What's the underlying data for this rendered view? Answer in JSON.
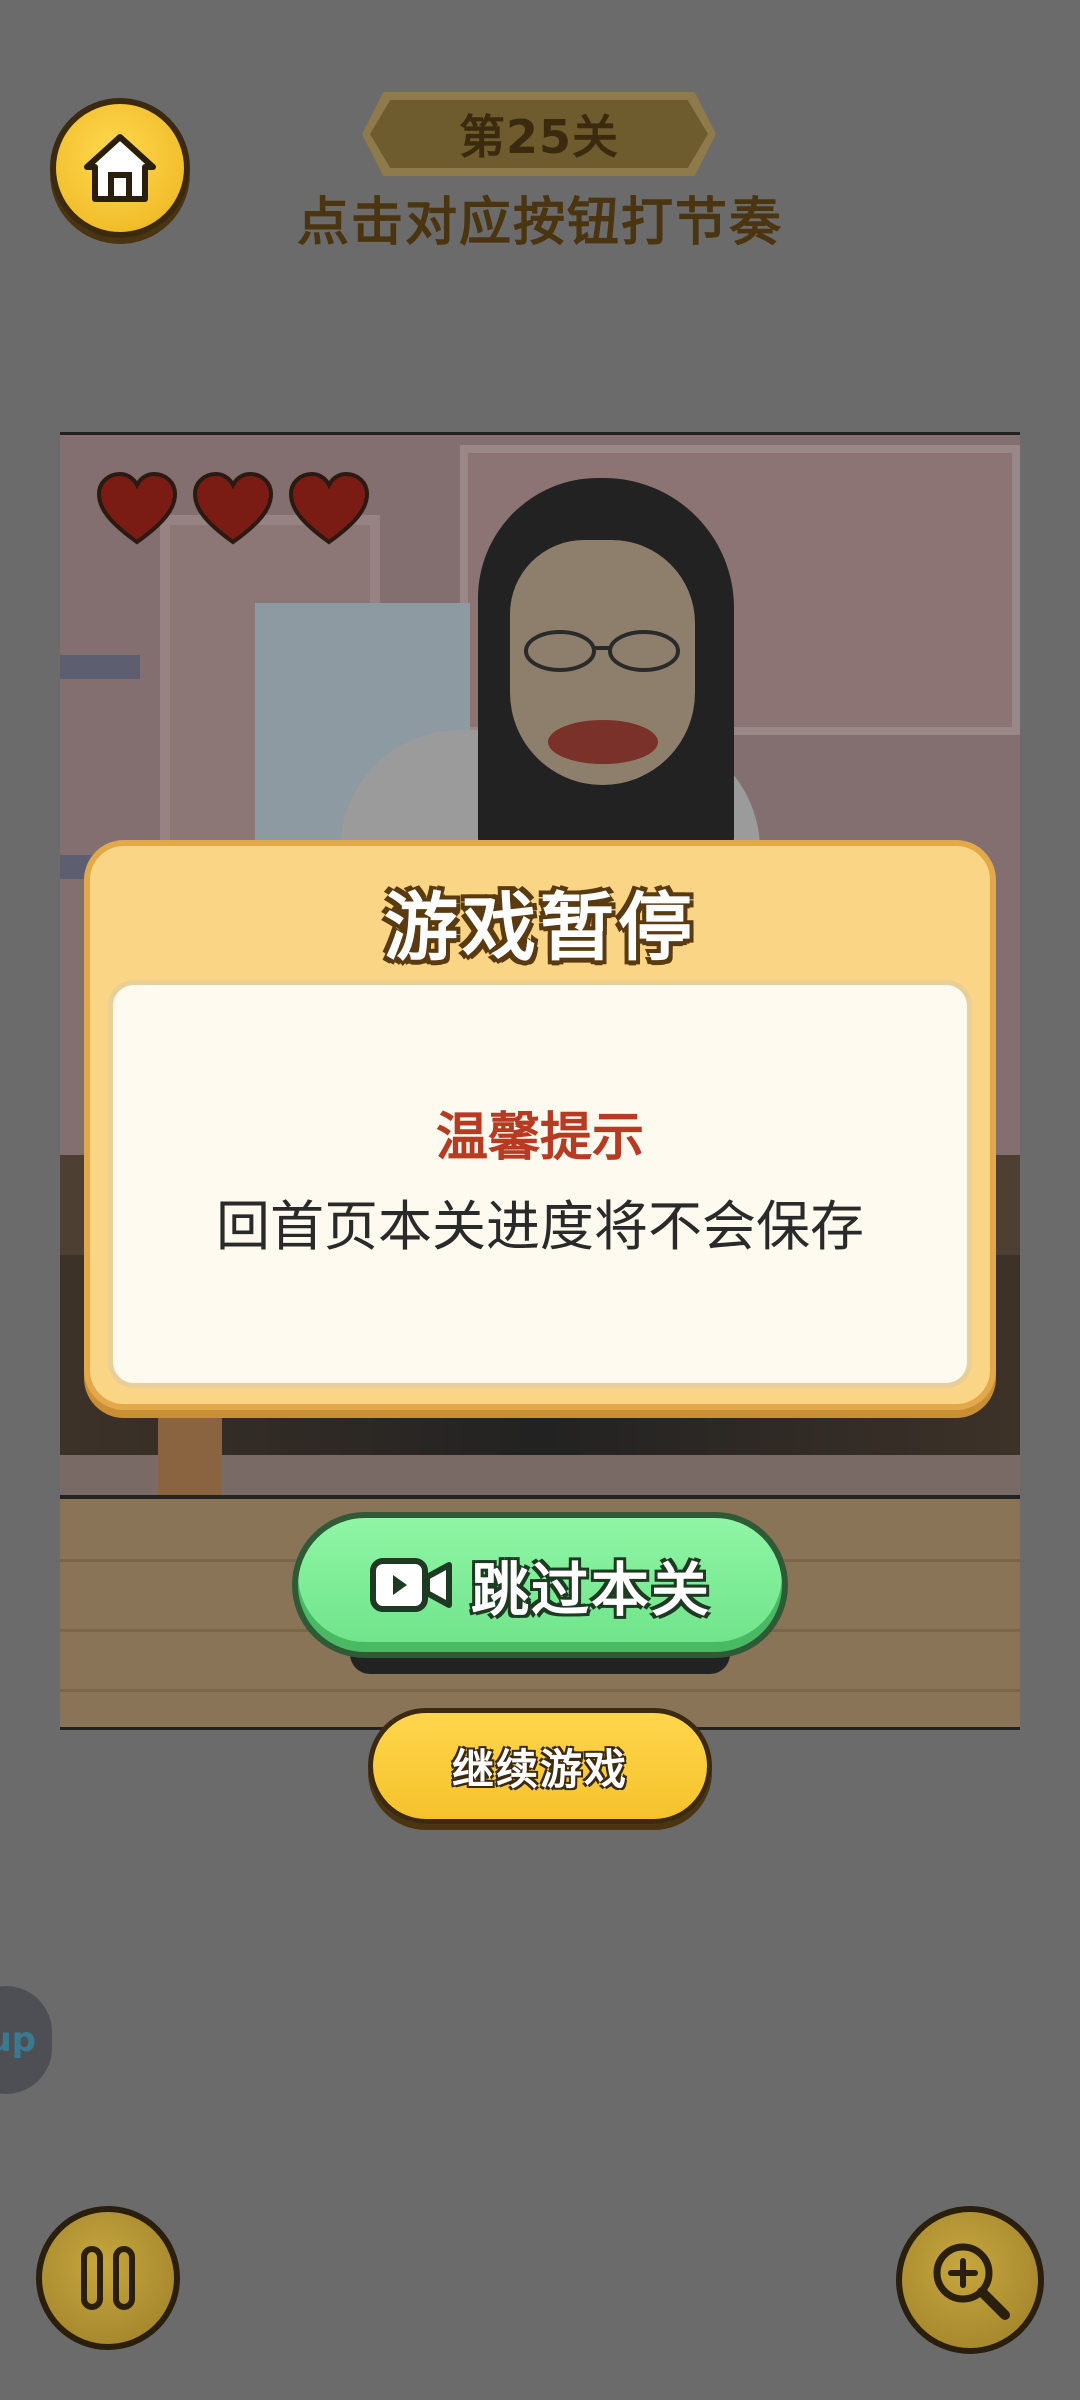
{
  "header": {
    "level_label": "第25关",
    "instruction": "点击对应按钮打节奏"
  },
  "game": {
    "lives": 3,
    "heart_icon": "heart-icon"
  },
  "pause_dialog": {
    "title": "游戏暂停",
    "tip_title": "温馨提示",
    "tip_message": "回首页本关进度将不会保存"
  },
  "buttons": {
    "skip_level": "跳过本关",
    "continue_game": "继续游戏"
  },
  "side_tab": {
    "label": "up"
  },
  "colors": {
    "overlay_bg": "#6b6b6b",
    "dialog_bg": "#fbd586",
    "tip_title_color": "#b73a22",
    "skip_button": "#7ee996",
    "continue_button": "#f5c22c"
  }
}
